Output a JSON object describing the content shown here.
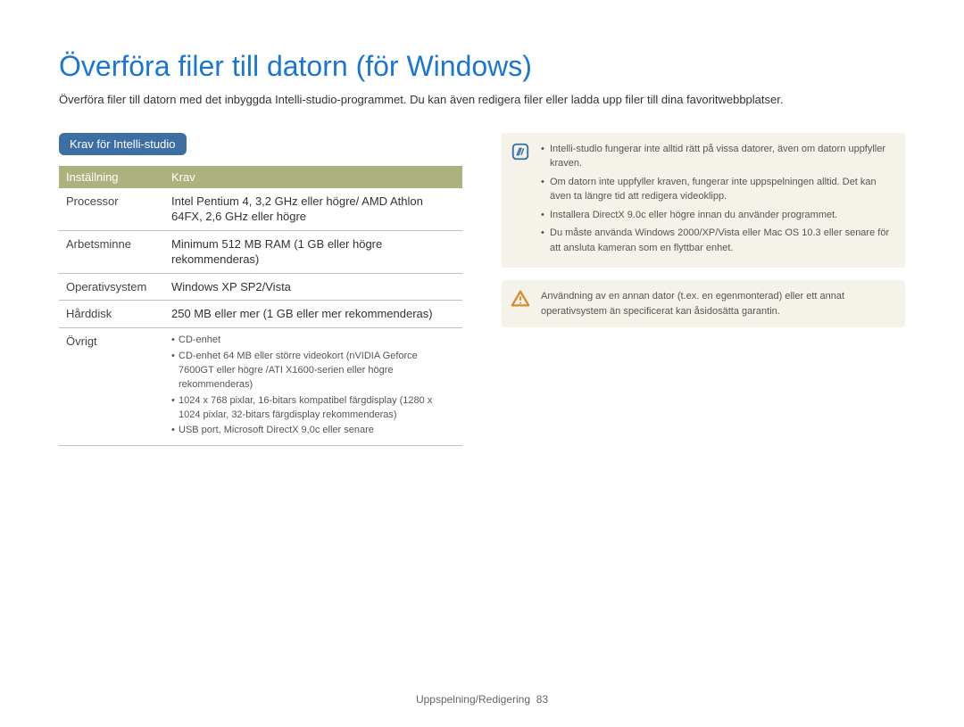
{
  "title": "Överföra filer till datorn (för Windows)",
  "intro": "Överföra filer till datorn med det inbyggda Intelli-studio-programmet. Du kan även redigera filer eller ladda upp filer till dina favoritwebbplatser.",
  "section_heading": "Krav för Intelli-studio",
  "table": {
    "headers": {
      "setting": "Inställning",
      "req": "Krav"
    },
    "rows": [
      {
        "setting": "Processor",
        "req": "Intel Pentium 4, 3,2 GHz eller högre/ AMD Athlon 64FX, 2,6 GHz eller högre"
      },
      {
        "setting": "Arbetsminne",
        "req": "Minimum 512 MB RAM (1 GB eller högre rekommenderas)"
      },
      {
        "setting": "Operativsystem",
        "req": "Windows XP SP2/Vista"
      },
      {
        "setting": "Hårddisk",
        "req": "250 MB eller mer (1 GB eller mer rekommenderas)"
      },
      {
        "setting": "Övrigt",
        "bullets": [
          "CD-enhet",
          "CD-enhet 64 MB eller större videokort (nVIDIA Geforce 7600GT eller högre /ATI X1600-serien eller högre rekommenderas)",
          "1024 x 768 pixlar, 16-bitars kompatibel färgdisplay (1280 x 1024 pixlar, 32-bitars färgdisplay rekommenderas)",
          "USB port, Microsoft DirectX 9,0c eller senare"
        ]
      }
    ]
  },
  "info_notes": [
    "Intelli-studio fungerar inte alltid rätt på vissa datorer, även om datorn uppfyller kraven.",
    "Om datorn inte uppfyller kraven, fungerar inte uppspelningen alltid. Det kan även ta längre tid att redigera videoklipp.",
    "Installera DirectX 9.0c eller högre innan du använder programmet.",
    "Du måste använda Windows 2000/XP/Vista eller Mac OS 10.3 eller senare för att ansluta kameran som en  flyttbar enhet."
  ],
  "warn_note": "Användning av en annan dator (t.ex. en egenmonterad) eller ett annat operativsystem än specificerat kan åsidosätta garantin.",
  "footer": {
    "section": "Uppspelning/Redigering",
    "page": "83"
  }
}
